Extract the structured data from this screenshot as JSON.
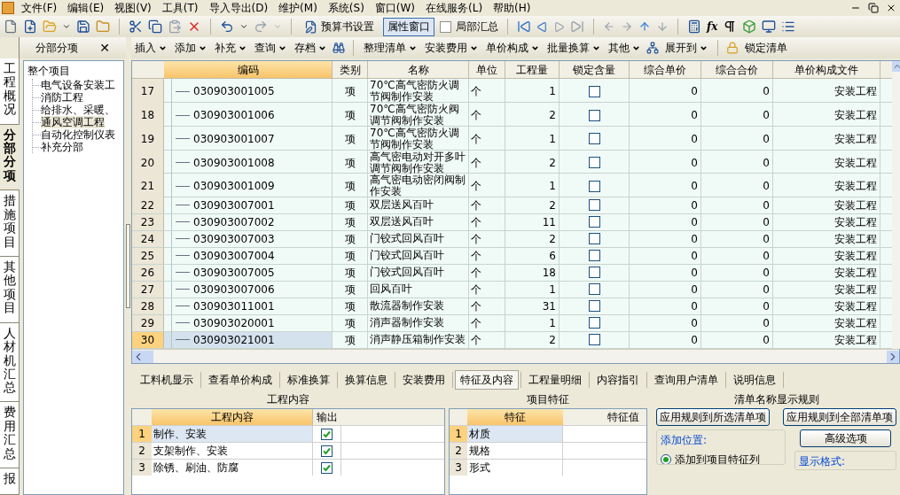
{
  "menu": [
    "文件(F)",
    "编辑(E)",
    "视图(V)",
    "工具(T)",
    "导入导出(D)",
    "维护(M)",
    "系统(S)",
    "窗口(W)",
    "在线服务(L)",
    "帮助(H)"
  ],
  "toolbar": {
    "budget_settings": "预算书设置",
    "property_window": {
      "label": "属性窗口",
      "selected": true
    },
    "partial_summary": {
      "label": "局部汇总",
      "checked": false
    },
    "function_label": "fx"
  },
  "side_tabs": [
    {
      "label": "工程概况",
      "selected": false
    },
    {
      "label": "分部分项",
      "selected": true
    },
    {
      "label": "措施项目",
      "selected": false
    },
    {
      "label": "其他项目",
      "selected": false
    },
    {
      "label": "人材机汇总",
      "selected": false
    },
    {
      "label": "费用汇总",
      "selected": false
    },
    {
      "label": "报",
      "selected": false
    }
  ],
  "tree_panel": {
    "title": "分部分项",
    "close": "✕",
    "root": {
      "label": "整个项目",
      "children": [
        {
          "label": "电气设备安装工",
          "selected": false
        },
        {
          "label": "消防工程",
          "selected": false
        },
        {
          "label": "给排水、采暖、",
          "selected": false
        },
        {
          "label": "通风空调工程",
          "selected": true
        },
        {
          "label": "自动化控制仪表",
          "selected": false
        },
        {
          "label": "补充分部",
          "selected": false
        }
      ]
    }
  },
  "actions": [
    {
      "label": "插入",
      "dropdown": true
    },
    {
      "label": "添加",
      "dropdown": true
    },
    {
      "label": "补充",
      "dropdown": true
    },
    {
      "label": "查询",
      "dropdown": true
    },
    {
      "label": "存档",
      "dropdown": true
    },
    {
      "label": "整理清单",
      "dropdown": true
    },
    {
      "label": "安装费用",
      "dropdown": true
    },
    {
      "label": "单价构成",
      "dropdown": true
    },
    {
      "label": "批量换算",
      "dropdown": true
    },
    {
      "label": "其他",
      "dropdown": true
    },
    {
      "label": "展开到",
      "dropdown": true
    },
    {
      "label": "锁定清单",
      "dropdown": false
    }
  ],
  "table": {
    "columns": [
      "编码",
      "类别",
      "名称",
      "单位",
      "工程量",
      "锁定含量",
      "综合单价",
      "综合合价",
      "单价构成文件"
    ],
    "rows": [
      {
        "num": "17",
        "code": "030903001005",
        "type": "项",
        "name": "70℃高气密防火调节阀制作安装",
        "unit": "个",
        "qty": "1",
        "locked": false,
        "unit_price": "0",
        "total": "0",
        "file": "安装工程",
        "selected": false
      },
      {
        "num": "18",
        "code": "030903001006",
        "type": "项",
        "name": "70℃高气密防火阀调节阀制作安装",
        "unit": "个",
        "qty": "2",
        "locked": false,
        "unit_price": "0",
        "total": "0",
        "file": "安装工程",
        "selected": false
      },
      {
        "num": "19",
        "code": "030903001007",
        "type": "项",
        "name": "70℃高气密防火调节阀制作安装",
        "unit": "个",
        "qty": "1",
        "locked": false,
        "unit_price": "0",
        "total": "0",
        "file": "安装工程",
        "selected": false
      },
      {
        "num": "20",
        "code": "030903001008",
        "type": "项",
        "name": "高气密电动对开多叶调节阀制作安装",
        "unit": "个",
        "qty": "2",
        "locked": false,
        "unit_price": "0",
        "total": "0",
        "file": "安装工程",
        "selected": false
      },
      {
        "num": "21",
        "code": "030903001009",
        "type": "项",
        "name": "高气密电动密闭阀制作安装",
        "unit": "个",
        "qty": "1",
        "locked": false,
        "unit_price": "0",
        "total": "0",
        "file": "安装工程",
        "selected": false
      },
      {
        "num": "22",
        "code": "030903007001",
        "type": "项",
        "name": "双层送风百叶",
        "unit": "个",
        "qty": "2",
        "locked": false,
        "unit_price": "0",
        "total": "0",
        "file": "安装工程",
        "selected": false
      },
      {
        "num": "23",
        "code": "030903007002",
        "type": "项",
        "name": "双层送风百叶",
        "unit": "个",
        "qty": "11",
        "locked": false,
        "unit_price": "0",
        "total": "0",
        "file": "安装工程",
        "selected": false
      },
      {
        "num": "24",
        "code": "030903007003",
        "type": "项",
        "name": "门铰式回风百叶",
        "unit": "个",
        "qty": "2",
        "locked": false,
        "unit_price": "0",
        "total": "0",
        "file": "安装工程",
        "selected": false
      },
      {
        "num": "25",
        "code": "030903007004",
        "type": "项",
        "name": "门铰式回风百叶",
        "unit": "个",
        "qty": "6",
        "locked": false,
        "unit_price": "0",
        "total": "0",
        "file": "安装工程",
        "selected": false
      },
      {
        "num": "26",
        "code": "030903007005",
        "type": "项",
        "name": "门铰式回风百叶",
        "unit": "个",
        "qty": "18",
        "locked": false,
        "unit_price": "0",
        "total": "0",
        "file": "安装工程",
        "selected": false
      },
      {
        "num": "27",
        "code": "030903007006",
        "type": "项",
        "name": "回风百叶",
        "unit": "个",
        "qty": "1",
        "locked": false,
        "unit_price": "0",
        "total": "0",
        "file": "安装工程",
        "selected": false
      },
      {
        "num": "28",
        "code": "030903011001",
        "type": "项",
        "name": "散流器制作安装",
        "unit": "个",
        "qty": "31",
        "locked": false,
        "unit_price": "0",
        "total": "0",
        "file": "安装工程",
        "selected": false
      },
      {
        "num": "29",
        "code": "030903020001",
        "type": "项",
        "name": "消声器制作安装",
        "unit": "个",
        "qty": "1",
        "locked": false,
        "unit_price": "0",
        "total": "0",
        "file": "安装工程",
        "selected": false
      },
      {
        "num": "30",
        "code": "030903021001",
        "type": "项",
        "name": "消声静压箱制作安装",
        "unit": "个",
        "qty": "2",
        "locked": false,
        "unit_price": "0",
        "total": "0",
        "file": "安装工程",
        "selected": true
      }
    ]
  },
  "bottom_tabs": [
    {
      "label": "工料机显示",
      "selected": false
    },
    {
      "label": "查看单价构成",
      "selected": false
    },
    {
      "label": "标准换算",
      "selected": false
    },
    {
      "label": "换算信息",
      "selected": false
    },
    {
      "label": "安装费用",
      "selected": false
    },
    {
      "label": "特征及内容",
      "selected": true
    },
    {
      "label": "工程量明细",
      "selected": false
    },
    {
      "label": "内容指引",
      "selected": false
    },
    {
      "label": "查询用户清单",
      "selected": false
    },
    {
      "label": "说明信息",
      "selected": false
    }
  ],
  "work_content": {
    "title": "工程内容",
    "columns": [
      "工程内容",
      "输出"
    ],
    "rows": [
      {
        "num": "1",
        "text": "制作、安装",
        "output": true,
        "selected": true
      },
      {
        "num": "2",
        "text": "支架制作、安装",
        "output": true,
        "selected": false
      },
      {
        "num": "3",
        "text": "除锈、刷油、防腐",
        "output": true,
        "selected": false
      }
    ]
  },
  "features": {
    "title": "项目特征",
    "columns": [
      "特征",
      "特征值"
    ],
    "rows": [
      {
        "num": "1",
        "text": "材质",
        "selected": true
      },
      {
        "num": "2",
        "text": "规格",
        "selected": false
      },
      {
        "num": "3",
        "text": "形式",
        "selected": false
      }
    ]
  },
  "rules": {
    "title": "清单名称显示规则",
    "buttons": [
      "应用规则到所选清单项",
      "应用规则到全部清单项"
    ],
    "position_label": "添加位置:",
    "options": [
      {
        "label": "添加到项目特征列",
        "selected": true
      }
    ],
    "advanced": "高级选项",
    "format_label": "显示格式:"
  }
}
